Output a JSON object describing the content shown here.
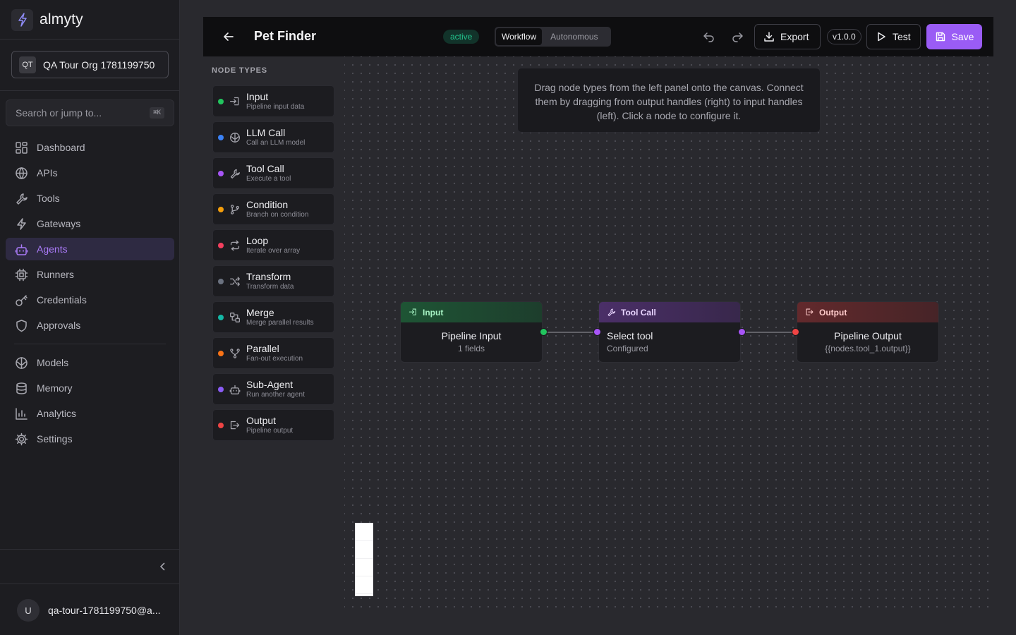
{
  "brand": {
    "name": "almyty"
  },
  "org": {
    "initials": "QT",
    "name": "QA Tour Org 1781199750"
  },
  "search": {
    "placeholder": "Search or jump to...",
    "shortcut": "⌘K"
  },
  "nav": {
    "primary": [
      {
        "label": "Dashboard",
        "icon": "dashboard-icon"
      },
      {
        "label": "APIs",
        "icon": "globe-icon"
      },
      {
        "label": "Tools",
        "icon": "wrench-icon"
      },
      {
        "label": "Gateways",
        "icon": "zap-icon"
      },
      {
        "label": "Agents",
        "icon": "bot-icon",
        "active": true
      },
      {
        "label": "Runners",
        "icon": "cpu-icon"
      },
      {
        "label": "Credentials",
        "icon": "key-icon"
      },
      {
        "label": "Approvals",
        "icon": "shield-icon"
      }
    ],
    "secondary": [
      {
        "label": "Models",
        "icon": "brain-icon"
      },
      {
        "label": "Memory",
        "icon": "database-icon"
      },
      {
        "label": "Analytics",
        "icon": "chart-icon"
      },
      {
        "label": "Settings",
        "icon": "gear-icon"
      }
    ]
  },
  "user": {
    "initial": "U",
    "email": "qa-tour-1781199750@a..."
  },
  "topbar": {
    "title": "Pet Finder",
    "status": "active",
    "modes": [
      "Workflow",
      "Autonomous"
    ],
    "active_mode": "Workflow",
    "export_label": "Export",
    "version": "v1.0.0",
    "test_label": "Test",
    "save_label": "Save"
  },
  "palette": {
    "title": "NODE TYPES",
    "items": [
      {
        "name": "Input",
        "desc": "Pipeline input data",
        "color": "#22c55e",
        "icon": "input-icon"
      },
      {
        "name": "LLM Call",
        "desc": "Call an LLM model",
        "color": "#3b82f6",
        "icon": "brain-icon"
      },
      {
        "name": "Tool Call",
        "desc": "Execute a tool",
        "color": "#a855f7",
        "icon": "wrench-icon"
      },
      {
        "name": "Condition",
        "desc": "Branch on condition",
        "color": "#f59e0b",
        "icon": "branch-icon"
      },
      {
        "name": "Loop",
        "desc": "Iterate over array",
        "color": "#f43f5e",
        "icon": "loop-icon"
      },
      {
        "name": "Transform",
        "desc": "Transform data",
        "color": "#6b7280",
        "icon": "shuffle-icon"
      },
      {
        "name": "Merge",
        "desc": "Merge parallel results",
        "color": "#14b8a6",
        "icon": "merge-icon"
      },
      {
        "name": "Parallel",
        "desc": "Fan-out execution",
        "color": "#f97316",
        "icon": "fork-icon"
      },
      {
        "name": "Sub-Agent",
        "desc": "Run another agent",
        "color": "#8b5cf6",
        "icon": "bot-icon"
      },
      {
        "name": "Output",
        "desc": "Pipeline output",
        "color": "#ef4444",
        "icon": "output-icon"
      }
    ]
  },
  "canvas": {
    "hint": "Drag node types from the left panel onto the canvas. Connect them by dragging from output handles (right) to input handles (left). Click a node to configure it.",
    "nodes": [
      {
        "type": "Input",
        "title": "Pipeline Input",
        "sub": "1 fields",
        "accent": "#22c55e",
        "head_color": "#a7f3c4"
      },
      {
        "type": "Tool Call",
        "title": "Select tool",
        "sub": "Configured",
        "accent": "#a855f7",
        "head_color": "#e9d5ff"
      },
      {
        "type": "Output",
        "title": "Pipeline Output",
        "sub": "{{nodes.tool_1.output}}",
        "accent": "#ef4444",
        "head_color": "#fecaca"
      }
    ]
  },
  "colors": {
    "accent": "#9a5cf5",
    "active_status": "#22c58d"
  }
}
